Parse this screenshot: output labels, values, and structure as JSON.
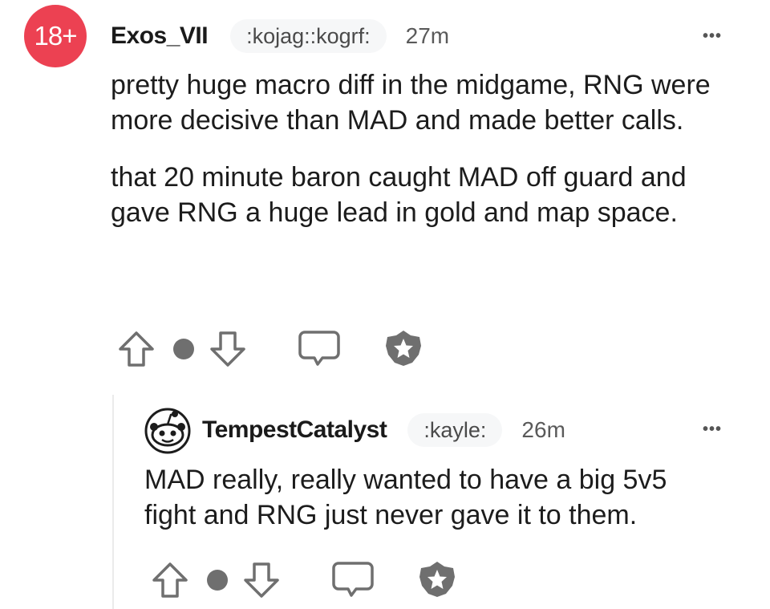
{
  "comment": {
    "avatar_text": "18+",
    "username": "Exos_VII",
    "flair": ":kojag::kogrf:",
    "time": "27m",
    "more": "•••",
    "paragraphs": [
      "pretty huge macro diff in the midgame, RNG were more decisive than MAD and made better calls.",
      "that 20 minute baron caught MAD off guard and gave RNG a huge lead in gold and map space."
    ],
    "actions": {
      "upvote_icon": "upvote-arrow-icon",
      "vote_dot_icon": "vote-dot-icon",
      "downvote_icon": "downvote-arrow-icon",
      "reply_icon": "speech-bubble-icon",
      "award_icon": "award-star-icon"
    }
  },
  "reply": {
    "username": "TempestCatalyst",
    "flair": ":kayle:",
    "time": "26m",
    "more": "•••",
    "text": "MAD really, really wanted to have a big 5v5 fight and RNG just never gave it to them.",
    "avatar_icon": "snoo-avatar-icon"
  },
  "colors": {
    "avatar_red": "#ec4152",
    "icon_gray": "#6f6f6f",
    "flair_bg": "#f6f7f8"
  }
}
